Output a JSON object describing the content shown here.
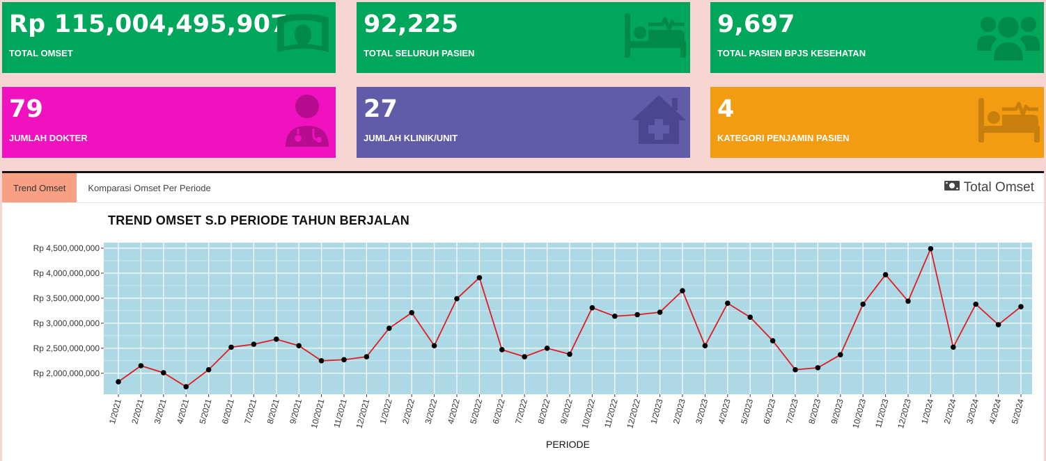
{
  "cards": [
    {
      "value": "Rp 115,004,495,907",
      "label": "TOTAL OMSET",
      "icon": "money-bill-icon",
      "color": "#00a65a"
    },
    {
      "value": "92,225",
      "label": "TOTAL SELURUH PASIEN",
      "icon": "hospital-bed-pulse-icon",
      "color": "#00a65a"
    },
    {
      "value": "9,697",
      "label": "TOTAL PASIEN BPJS KESEHATAN",
      "icon": "users-icon",
      "color": "#00a65a"
    },
    {
      "value": "79",
      "label": "JUMLAH DOKTER",
      "icon": "doctor-icon",
      "color": "#f012be"
    },
    {
      "value": "27",
      "label": "JUMLAH KLINIK/UNIT",
      "icon": "clinic-house-icon",
      "color": "#605ca8"
    },
    {
      "value": "4",
      "label": "KATEGORI PENJAMIN PASIEN",
      "icon": "hospital-bed-pulse-icon",
      "color": "#f39c12"
    }
  ],
  "tabs": [
    {
      "label": "Trend Omset",
      "active": true
    },
    {
      "label": "Komparasi Omset Per Periode",
      "active": false
    }
  ],
  "panel": {
    "title": "Total Omset",
    "icon": "money-bill-icon"
  },
  "chart_data": {
    "type": "line",
    "title": "TREND OMSET S.D PERIODE TAHUN BERJALAN",
    "xlabel": "PERIODE",
    "ylabel": "",
    "categories": [
      "1/2021",
      "2/2021",
      "3/2021",
      "4/2021",
      "5/2021",
      "6/2021",
      "7/2021",
      "8/2021",
      "9/2021",
      "10/2021",
      "11/2021",
      "12/2021",
      "1/2022",
      "2/2022",
      "3/2022",
      "4/2022",
      "5/2022",
      "6/2022",
      "7/2022",
      "8/2022",
      "9/2022",
      "10/2022",
      "11/2022",
      "12/2022",
      "1/2023",
      "2/2023",
      "3/2023",
      "4/2023",
      "5/2023",
      "6/2023",
      "7/2023",
      "8/2023",
      "9/2023",
      "10/2023",
      "11/2023",
      "12/2023",
      "1/2024",
      "2/2024",
      "3/2024",
      "4/2024",
      "5/2024"
    ],
    "values": [
      1830000000,
      2150000000,
      2010000000,
      1730000000,
      2070000000,
      2520000000,
      2580000000,
      2680000000,
      2550000000,
      2250000000,
      2270000000,
      2330000000,
      2900000000,
      3210000000,
      2550000000,
      3490000000,
      3910000000,
      2470000000,
      2330000000,
      2500000000,
      2380000000,
      3310000000,
      3140000000,
      3170000000,
      3220000000,
      3650000000,
      2550000000,
      3400000000,
      3120000000,
      2650000000,
      2070000000,
      2110000000,
      2370000000,
      3380000000,
      3970000000,
      3440000000,
      4490000000,
      2520000000,
      3380000000,
      2970000000,
      3330000000
    ],
    "yticks": [
      2000000000,
      2500000000,
      3000000000,
      3500000000,
      4000000000,
      4500000000
    ],
    "ytick_labels": [
      "Rp 2,000,000,000",
      "Rp 2,500,000,000",
      "Rp 3,000,000,000",
      "Rp 3,500,000,000",
      "Rp 4,000,000,000",
      "Rp 4,500,000,000"
    ],
    "ylim": [
      1580000000,
      4610000000
    ],
    "grid": true,
    "colors": {
      "plot_bg": "#add8e6",
      "line": "#e31a1c",
      "point": "#000000",
      "grid": "#ffffff"
    }
  }
}
